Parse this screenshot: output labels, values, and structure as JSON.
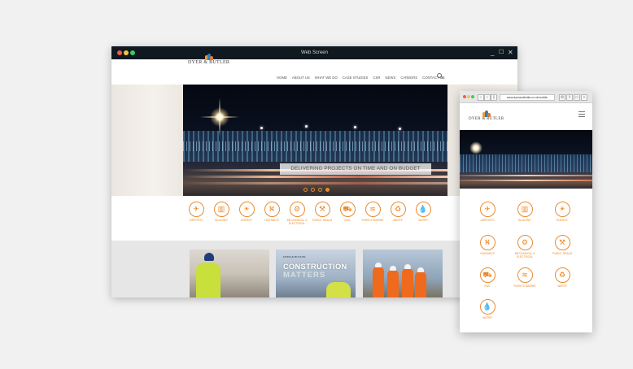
{
  "colors": {
    "accent_orange": "#e98b2f",
    "window_bar": "#101820",
    "lower_band": "#e6e6e6"
  },
  "desktop": {
    "window_title": "Web Screen",
    "window_controls": {
      "minimize_icon": "minimize-icon",
      "maximize_icon": "maximize-icon",
      "close_icon": "close-icon"
    },
    "logo_text": "DYER & BUTLER",
    "nav": [
      "HOME",
      "ABOUT US",
      "WHAT WE DO",
      "CASE STUDIES",
      "CSR",
      "NEWS",
      "CAREERS",
      "CONTACT US"
    ],
    "search_icon": "search-icon",
    "hero": {
      "caption": "DELIVERING PROJECTS ON TIME AND ON BUDGET",
      "slide_count": 4,
      "active_slide": 4
    },
    "sectors": [
      {
        "label": "AIRPORTS",
        "icon": "airport-icon"
      },
      {
        "label": "BUILDING",
        "icon": "building-icon"
      },
      {
        "label": "ENERGY",
        "icon": "energy-icon"
      },
      {
        "label": "HIGHWAYS",
        "icon": "highways-icon"
      },
      {
        "label": "MECHANICAL &\nELECTRICAL",
        "icon": "mechanical-electrical-icon"
      },
      {
        "label": "PUBLIC REALM",
        "icon": "public-realm-icon"
      },
      {
        "label": "RAIL",
        "icon": "rail-icon"
      },
      {
        "label": "RIVER & MARINE",
        "icon": "river-marine-icon"
      },
      {
        "label": "WASTE",
        "icon": "waste-icon"
      },
      {
        "label": "WATER",
        "icon": "water-icon"
      }
    ],
    "cards": [
      {
        "name": "worker-photo"
      },
      {
        "name": "construction-matters",
        "mini_logo": "DYER & BUTLER",
        "line1": "CONSTRUCTION",
        "line2": "MATTERS"
      },
      {
        "name": "team-photo"
      }
    ]
  },
  "mobile": {
    "url": "www.dyerandbutler.co.uk/mobile",
    "logo_text": "DYER & BUTLER",
    "menu_icon": "hamburger-menu-icon",
    "sectors": [
      {
        "label": "AIRPORTS",
        "icon": "airport-icon"
      },
      {
        "label": "BUILDING",
        "icon": "building-icon"
      },
      {
        "label": "ENERGY",
        "icon": "energy-icon"
      },
      {
        "label": "HIGHWAYS",
        "icon": "highways-icon"
      },
      {
        "label": "MECHANICAL &\nELECTRICAL",
        "icon": "mechanical-electrical-icon"
      },
      {
        "label": "PUBLIC REALM",
        "icon": "public-realm-icon"
      },
      {
        "label": "RAIL",
        "icon": "rail-icon"
      },
      {
        "label": "RIVER & MARINE",
        "icon": "river-marine-icon"
      },
      {
        "label": "WASTE",
        "icon": "waste-icon"
      },
      {
        "label": "WATER",
        "icon": "water-icon"
      }
    ]
  }
}
